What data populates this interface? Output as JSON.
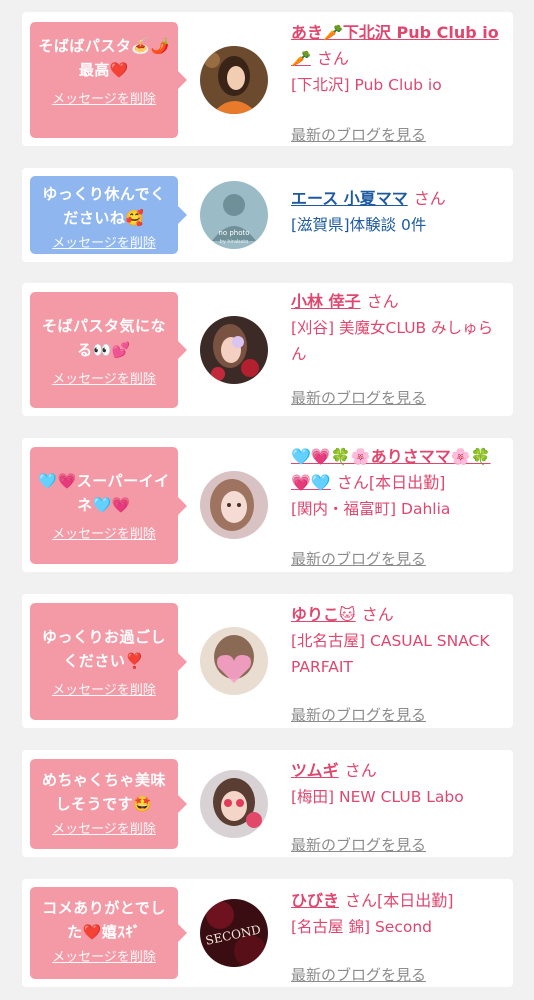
{
  "delete_label": "メッセージを削除",
  "blog_label": "最新のブログを見る",
  "san_label": "さん",
  "items": [
    {
      "message": "そばばパスタ🍝🌶️最高❤️",
      "name": "あき🥕下北沢 Pub Club io🥕",
      "status": "",
      "shop": "[下北沢] Pub Club io"
    },
    {
      "message": "ゆっくり休んでくださいね🥰",
      "name": "エース 小夏ママ",
      "status": "",
      "shop": "[滋賀県]体験談 0件",
      "avatar_text_1": "no photo",
      "avatar_text_2": "by hirabato"
    },
    {
      "message": "そばパスタ気になる👀💕",
      "name": "小林 倖子",
      "status": "",
      "shop": "[刈谷] 美魔女CLUB みしゅらん"
    },
    {
      "message": "🩵💗スーパーイイネ🩵💗",
      "name": "🩵💗🍀🌸ありさママ🌸🍀💗🩵",
      "status": "[本日出勤]",
      "shop": "[関内・福富町] Dahlia"
    },
    {
      "message": "ゆっくりお過ごしください❣️",
      "name": "ゆりこ🐱",
      "status": "",
      "shop": "[北名古屋] CASUAL SNACK PARFAIT"
    },
    {
      "message": "めちゃくちゃ美味しそうです🤩",
      "name": "ツムギ",
      "status": "",
      "shop": "[梅田] NEW CLUB Labo"
    },
    {
      "message": "コメありがとでした❤️嬉ｽｷﾞ",
      "name": "ひびき",
      "status": "[本日出勤]",
      "shop": "[名古屋 錦] Second",
      "avatar_text_1": "SECOND"
    }
  ],
  "colors": {
    "pink_bubble": "#f49aa6",
    "blue_bubble": "#8fb6ef",
    "name_pink": "#e0476f",
    "name_blue": "#1e5aa0",
    "link_gray": "#8c8c8c"
  }
}
